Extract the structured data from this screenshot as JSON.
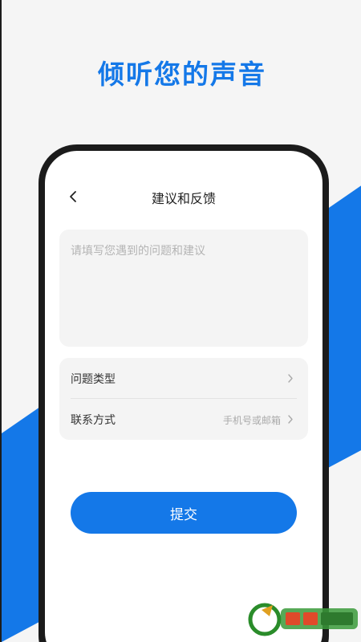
{
  "headline": "倾听您的声音",
  "colors": {
    "accent": "#1478e8",
    "phone_frame": "#1b1b1b",
    "background": "#f5f5f5",
    "card": "#f4f4f4"
  },
  "nav": {
    "back_icon": "chevron-left-icon",
    "title": "建议和反馈"
  },
  "feedback": {
    "placeholder": "请填写您遇到的问题和建议",
    "value": ""
  },
  "options": [
    {
      "label": "问题类型",
      "hint": "",
      "icon": "chevron-right-icon"
    },
    {
      "label": "联系方式",
      "hint": "手机号或邮箱",
      "icon": "chevron-right-icon"
    }
  ],
  "submit_label": "提交"
}
